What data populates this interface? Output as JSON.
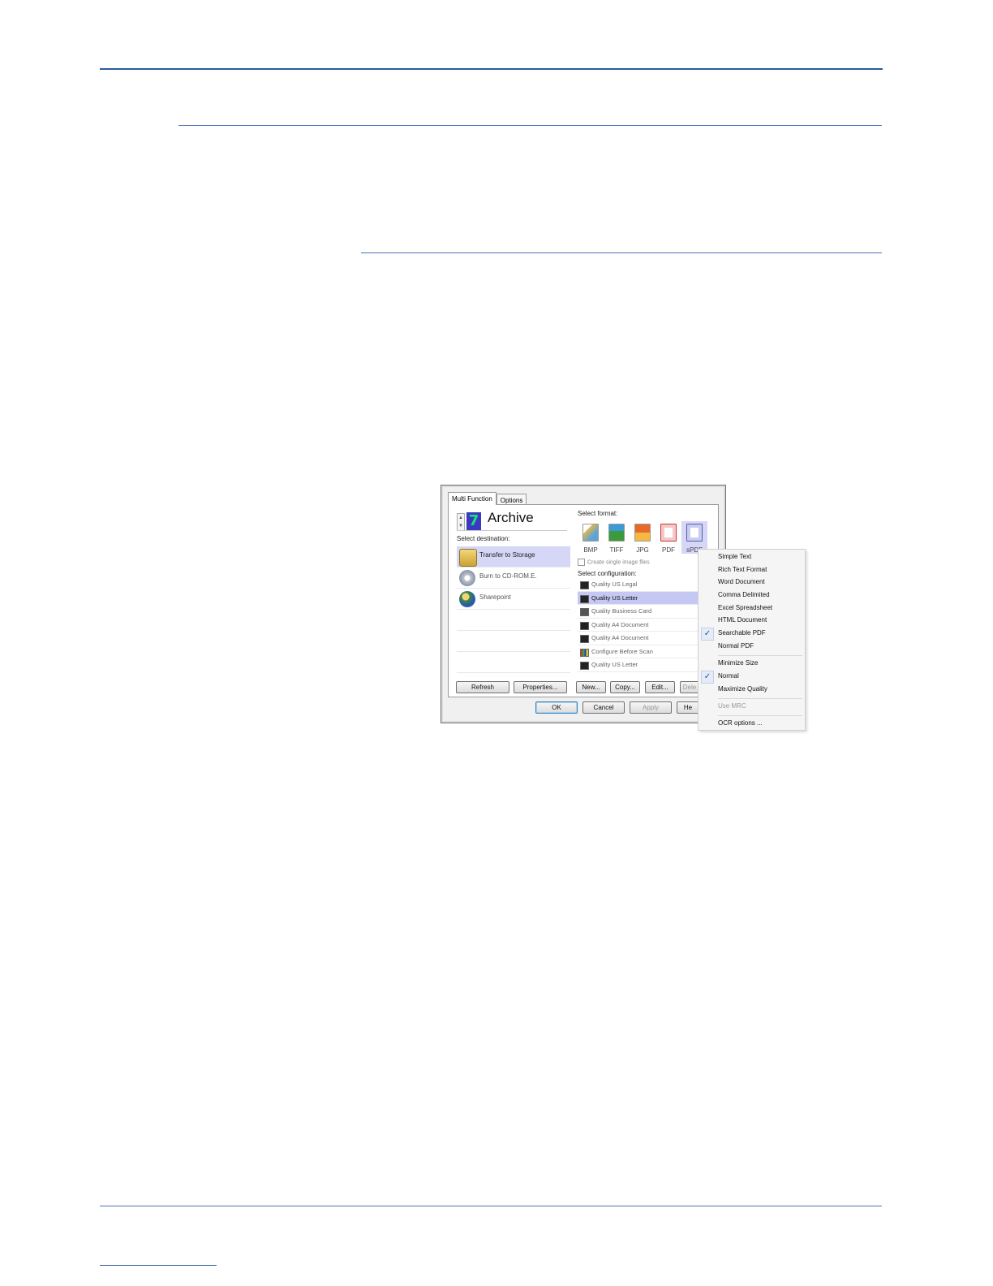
{
  "dialog": {
    "tabs": [
      "Multi Function",
      "Options"
    ],
    "destination_name": "Archive",
    "destination_number": "7",
    "select_destination_label": "Select destination:",
    "destinations": [
      "Transfer to Storage",
      "Burn to CD-ROM.E.",
      "Sharepoint"
    ],
    "select_format_label": "Select format:",
    "formats": [
      "BMP",
      "TIFF",
      "JPG",
      "PDF",
      "sPDF"
    ],
    "create_single_label": "Create single image files",
    "select_configuration_label": "Select configuration:",
    "configurations": [
      "Quality US Legal",
      "Quality US Letter",
      "Quality Business Card",
      "Quality A4 Document",
      "Quality A4 Document",
      "Configure Before Scan",
      "Quality US Letter"
    ],
    "buttons": {
      "refresh": "Refresh",
      "properties": "Properties...",
      "new": "New...",
      "copy": "Copy...",
      "edit": "Edit...",
      "delete": "Dele",
      "ok": "OK",
      "cancel": "Cancel",
      "apply": "Apply",
      "help": "He"
    }
  },
  "context_menu": {
    "items": [
      "Simple Text",
      "Rich Text Format",
      "Word Document",
      "Comma Delimited",
      "Excel Spreadsheet",
      "HTML Document",
      "Searchable PDF",
      "Normal PDF"
    ],
    "checked_item": "Searchable PDF",
    "quality_items": [
      "Minimize Size",
      "Normal",
      "Maximize Quality"
    ],
    "checked_quality": "Normal",
    "use_mrc": "Use MRC",
    "ocr_options": "OCR options ..."
  },
  "colors": {
    "accent_rule": "#2c5aa0",
    "selection": "#d6d6f7",
    "dest_badge": "#3a3ac0"
  }
}
